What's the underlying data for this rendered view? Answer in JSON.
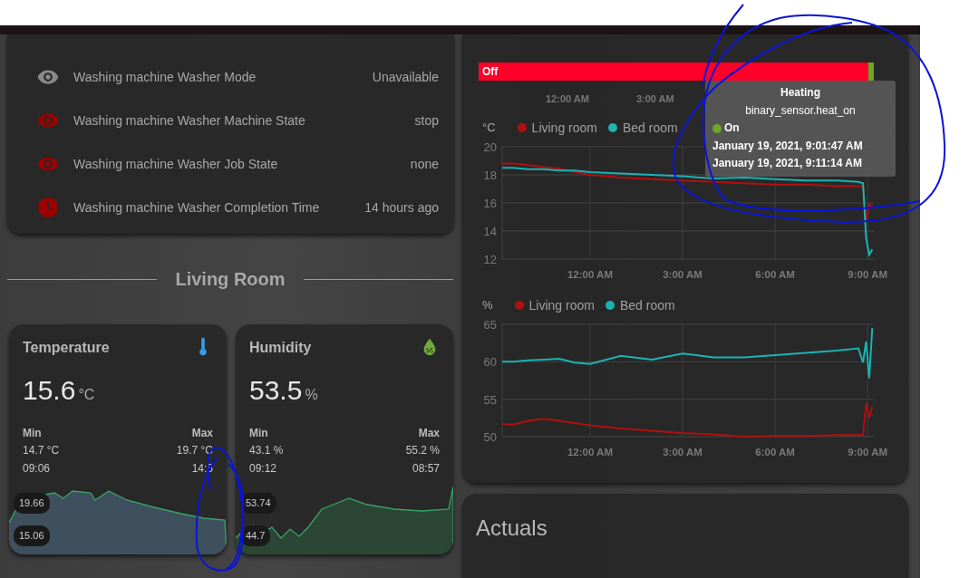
{
  "entities": [
    {
      "name": "Washing machine Washer Mode",
      "state": "Unavailable",
      "kind": "eye",
      "color": "#8a8a8a"
    },
    {
      "name": "Washing machine Washer Machine State",
      "state": "stop",
      "kind": "eye",
      "color": "#9c0000"
    },
    {
      "name": "Washing machine Washer Job State",
      "state": "none",
      "kind": "eye",
      "color": "#9c0000"
    },
    {
      "name": "Washing machine Washer Completion Time",
      "state": "14 hours ago",
      "kind": "clock",
      "color": "#9c0000"
    }
  ],
  "section_heading": "Living Room",
  "sensor_cards": [
    {
      "kind": "temperature",
      "name": "Temperature",
      "value": "15.6",
      "unit": "°C",
      "min_label": "Min",
      "min_value": "14.7 °C",
      "min_time": "09:06",
      "max_label": "Max",
      "max_value": "19.7 °C",
      "max_time": "14:5",
      "bound_high": "19.66",
      "bound_low": "15.06"
    },
    {
      "kind": "humidity",
      "name": "Humidity",
      "value": "53.5",
      "unit": "%",
      "min_label": "Min",
      "min_value": "43.1 %",
      "min_time": "09:12",
      "max_label": "Max",
      "max_value": "55.2 %",
      "max_time": "08:57",
      "bound_high": "53.74",
      "bound_low": "44.7"
    }
  ],
  "history": {
    "timeline": {
      "segments": [
        {
          "label": "Off",
          "color": "#ff0029",
          "level": 0.986
        },
        {
          "color": "#6aa628",
          "level": 0.014
        }
      ]
    },
    "timeline_axis": [
      "12:00 AM",
      "3:00 AM"
    ],
    "charts": [
      {
        "chart_data": {
          "type": "line",
          "grid": true,
          "legend": "top",
          "ylabel": "°C",
          "xlim": [
            -2.85,
            9.2
          ],
          "ylim": [
            12,
            20
          ],
          "x": [
            -2.85,
            -2.5,
            -2,
            -1.5,
            -1,
            -0.5,
            0,
            1,
            2,
            3,
            4,
            5,
            6,
            7,
            8,
            8.7,
            8.85,
            8.95,
            9.05,
            9.15
          ],
          "xticks": [
            {
              "value": 0,
              "label": "12:00 AM"
            },
            {
              "value": 3,
              "label": "3:00 AM"
            },
            {
              "value": 6,
              "label": "6:00 AM"
            },
            {
              "value": 9,
              "label": "9:00 AM"
            }
          ],
          "yticks": [
            12,
            14,
            16,
            18,
            20
          ],
          "series": [
            {
              "name": "Living room",
              "color": "#b01010",
              "values": [
                18.8,
                18.8,
                18.7,
                18.55,
                18.45,
                18.2,
                18.0,
                17.8,
                17.7,
                17.6,
                17.5,
                17.4,
                17.3,
                17.3,
                17.2,
                17.2,
                17.2,
                14.8,
                15.9,
                15.7
              ]
            },
            {
              "name": "Bed room",
              "color": "#1cb3b3",
              "values": [
                18.5,
                18.5,
                18.4,
                18.4,
                18.3,
                18.3,
                18.2,
                18.1,
                18.0,
                17.9,
                17.75,
                17.8,
                17.7,
                17.6,
                17.6,
                17.5,
                17.4,
                13.5,
                12.3,
                12.7
              ]
            }
          ]
        }
      },
      {
        "chart_data": {
          "type": "line",
          "grid": true,
          "legend": "top",
          "ylabel": "%",
          "xlim": [
            -2.85,
            9.2
          ],
          "ylim": [
            50,
            65
          ],
          "x": [
            -2.85,
            -2.5,
            -2,
            -1.5,
            -1,
            -0.5,
            0,
            1,
            2,
            3,
            4,
            5,
            6,
            7,
            8,
            8.7,
            8.85,
            8.95,
            9.05,
            9.15
          ],
          "xticks": [
            {
              "value": 0,
              "label": "12:00 AM"
            },
            {
              "value": 3,
              "label": "3:00 AM"
            },
            {
              "value": 6,
              "label": "6:00 AM"
            },
            {
              "value": 9,
              "label": "9:00 AM"
            }
          ],
          "yticks": [
            50,
            55,
            60,
            65
          ],
          "series": [
            {
              "name": "Living room",
              "color": "#b01010",
              "values": [
                51.7,
                51.6,
                52.1,
                52.4,
                52.1,
                51.8,
                51.5,
                51.1,
                50.8,
                50.5,
                50.3,
                50.0,
                50.1,
                50.1,
                50.2,
                50.2,
                50.2,
                54.5,
                52.5,
                54.0
              ]
            },
            {
              "name": "Bed room",
              "color": "#1cb3b3",
              "values": [
                60,
                60,
                60.2,
                60.3,
                60.4,
                59.9,
                59.7,
                60.8,
                60.3,
                61.1,
                60.6,
                60.6,
                60.9,
                61.2,
                61.5,
                61.8,
                59.9,
                62.7,
                57.8,
                64.5
              ]
            }
          ]
        }
      }
    ],
    "tooltip": {
      "title": "Heating",
      "entity": "binary_sensor.heat_on",
      "state": {
        "label": "On",
        "color": "#6aa628"
      },
      "start": "January 19, 2021, 9:01:47 AM",
      "end": "January 19, 2021, 9:11:14 AM"
    }
  },
  "actuals": {
    "title": "Actuals"
  }
}
